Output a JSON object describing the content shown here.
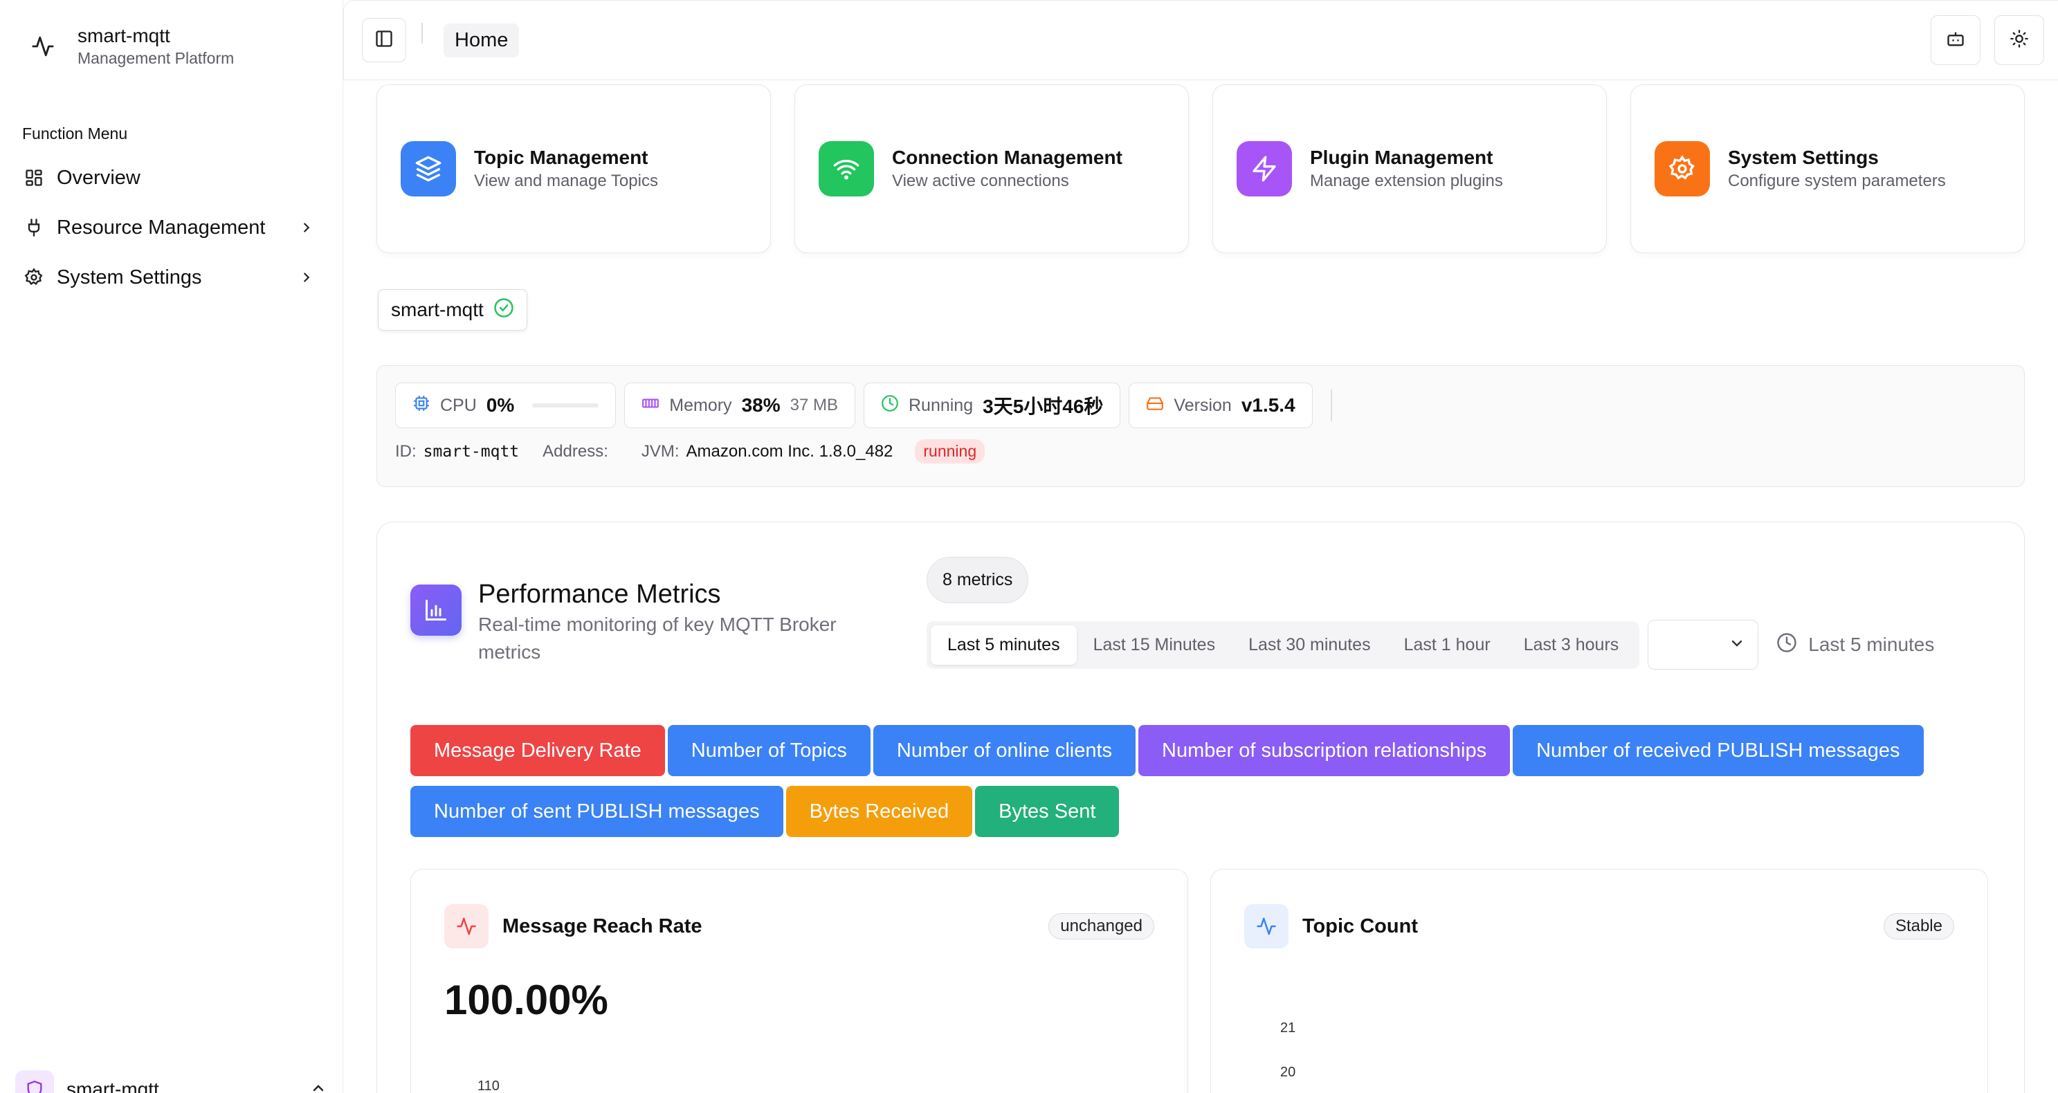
{
  "sidebar": {
    "brand_name": "smart-mqtt",
    "brand_sub": "Management Platform",
    "menu_title": "Function Menu",
    "items": [
      {
        "label": "Overview"
      },
      {
        "label": "Resource Management"
      },
      {
        "label": "System Settings"
      }
    ],
    "footer_name": "smart-mqtt"
  },
  "topbar": {
    "breadcrumb": "Home"
  },
  "quick_cards": [
    {
      "title": "Topic Management",
      "sub": "View and manage Topics",
      "color": "#3b82f6"
    },
    {
      "title": "Connection Management",
      "sub": "View active connections",
      "color": "#22c55e"
    },
    {
      "title": "Plugin Management",
      "sub": "Manage extension plugins",
      "color": "#a855f7"
    },
    {
      "title": "System Settings",
      "sub": "Configure system parameters",
      "color": "#f97316"
    }
  ],
  "node": {
    "name": "smart-mqtt"
  },
  "status": {
    "cpu_label": "CPU",
    "cpu_value": "0%",
    "cpu_percent": 0,
    "memory_label": "Memory",
    "memory_value": "38%",
    "memory_extra": "37 MB",
    "running_label": "Running",
    "running_value": "3天5小时46秒",
    "version_label": "Version",
    "version_value": "v1.5.4",
    "id_label": "ID:",
    "id_value": "smart-mqtt",
    "address_label": "Address:",
    "jvm_label": "JVM:",
    "jvm_value": "Amazon.com Inc. 1.8.0_482",
    "state": "running"
  },
  "perf": {
    "title": "Performance Metrics",
    "desc": "Real-time monitoring of key MQTT Broker metrics",
    "metric_count": "8 metrics",
    "ranges": [
      "Last 5 minutes",
      "Last 15 Minutes",
      "Last 30 minutes",
      "Last 1 hour",
      "Last 3 hours"
    ],
    "active_range": "Last 5 minutes",
    "current_range": "Last 5 minutes",
    "tags": [
      {
        "label": "Message Delivery Rate",
        "color": "#ef4444"
      },
      {
        "label": "Number of Topics",
        "color": "#3b82f6"
      },
      {
        "label": "Number of online clients",
        "color": "#3b82f6"
      },
      {
        "label": "Number of subscription relationships",
        "color": "#8b5cf6"
      },
      {
        "label": "Number of received PUBLISH messages",
        "color": "#3b82f6"
      },
      {
        "label": "Number of sent PUBLISH messages",
        "color": "#3b82f6"
      },
      {
        "label": "Bytes Received",
        "color": "#f59e0b"
      },
      {
        "label": "Bytes Sent",
        "color": "#22b07d"
      }
    ]
  },
  "charts": [
    {
      "title": "Message Reach Rate",
      "badge": "unchanged",
      "big": "100.00%",
      "ticks": [
        "110"
      ]
    },
    {
      "title": "Topic Count",
      "badge": "Stable",
      "ticks": [
        "21",
        "20"
      ]
    }
  ]
}
